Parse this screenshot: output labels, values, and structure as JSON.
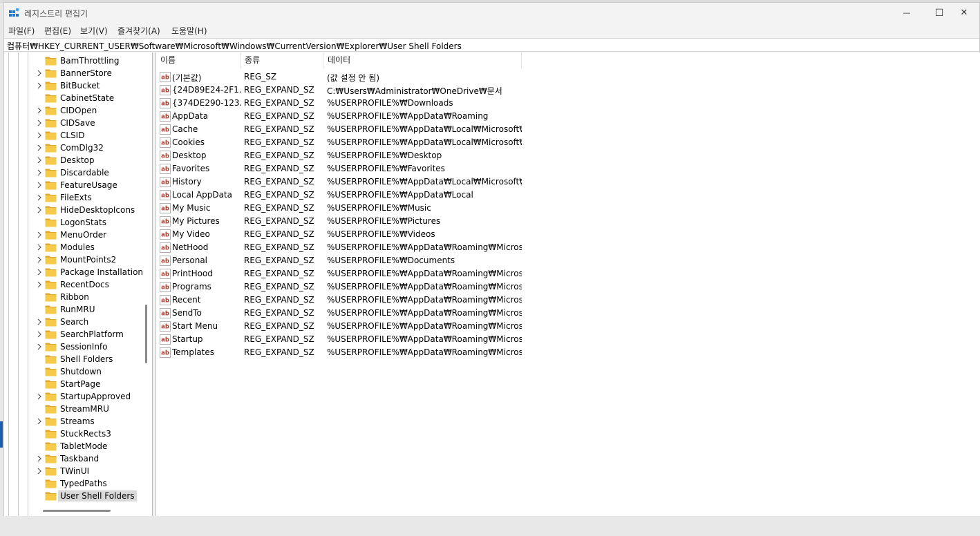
{
  "window": {
    "title": "레지스트리 편집기",
    "app_icon": "registry-editor-icon",
    "controls": {
      "minimize": "—",
      "maximize": "☐",
      "close": "✕"
    }
  },
  "menubar": {
    "items": [
      "파일(F)",
      "편집(E)",
      "보기(V)",
      "즐겨찾기(A)",
      "도움말(H)"
    ]
  },
  "address": {
    "path": "컴퓨터₩HKEY_CURRENT_USER₩Software₩Microsoft₩Windows₩CurrentVersion₩Explorer₩User Shell Folders"
  },
  "tree": {
    "items": [
      {
        "label": "BamThrottling",
        "expandable": false
      },
      {
        "label": "BannerStore",
        "expandable": true
      },
      {
        "label": "BitBucket",
        "expandable": true
      },
      {
        "label": "CabinetState",
        "expandable": false
      },
      {
        "label": "CIDOpen",
        "expandable": true
      },
      {
        "label": "CIDSave",
        "expandable": true
      },
      {
        "label": "CLSID",
        "expandable": true
      },
      {
        "label": "ComDlg32",
        "expandable": true
      },
      {
        "label": "Desktop",
        "expandable": true
      },
      {
        "label": "Discardable",
        "expandable": true
      },
      {
        "label": "FeatureUsage",
        "expandable": true
      },
      {
        "label": "FileExts",
        "expandable": true
      },
      {
        "label": "HideDesktopIcons",
        "expandable": true
      },
      {
        "label": "LogonStats",
        "expandable": false
      },
      {
        "label": "MenuOrder",
        "expandable": true
      },
      {
        "label": "Modules",
        "expandable": true
      },
      {
        "label": "MountPoints2",
        "expandable": true
      },
      {
        "label": "Package Installation",
        "expandable": true
      },
      {
        "label": "RecentDocs",
        "expandable": true
      },
      {
        "label": "Ribbon",
        "expandable": false
      },
      {
        "label": "RunMRU",
        "expandable": false
      },
      {
        "label": "Search",
        "expandable": true
      },
      {
        "label": "SearchPlatform",
        "expandable": true
      },
      {
        "label": "SessionInfo",
        "expandable": true
      },
      {
        "label": "Shell Folders",
        "expandable": false
      },
      {
        "label": "Shutdown",
        "expandable": false
      },
      {
        "label": "StartPage",
        "expandable": false
      },
      {
        "label": "StartupApproved",
        "expandable": true
      },
      {
        "label": "StreamMRU",
        "expandable": false
      },
      {
        "label": "Streams",
        "expandable": true
      },
      {
        "label": "StuckRects3",
        "expandable": false
      },
      {
        "label": "TabletMode",
        "expandable": false
      },
      {
        "label": "Taskband",
        "expandable": true
      },
      {
        "label": "TWinUI",
        "expandable": true
      },
      {
        "label": "TypedPaths",
        "expandable": false
      },
      {
        "label": "User Shell Folders",
        "expandable": false,
        "selected": true
      }
    ]
  },
  "list": {
    "columns": [
      "이름",
      "종류",
      "데이터"
    ],
    "rows": [
      {
        "name": "(기본값)",
        "type": "REG_SZ",
        "data": "(값 설정 안 됨)"
      },
      {
        "name": "{24D89E24-2F1...",
        "type": "REG_EXPAND_SZ",
        "data": "C:₩Users₩Administrator₩OneDrive₩문서"
      },
      {
        "name": "{374DE290-123...",
        "type": "REG_EXPAND_SZ",
        "data": "%USERPROFILE%₩Downloads"
      },
      {
        "name": "AppData",
        "type": "REG_EXPAND_SZ",
        "data": "%USERPROFILE%₩AppData₩Roaming"
      },
      {
        "name": "Cache",
        "type": "REG_EXPAND_SZ",
        "data": "%USERPROFILE%₩AppData₩Local₩Microsoft₩W..."
      },
      {
        "name": "Cookies",
        "type": "REG_EXPAND_SZ",
        "data": "%USERPROFILE%₩AppData₩Local₩Microsoft₩W..."
      },
      {
        "name": "Desktop",
        "type": "REG_EXPAND_SZ",
        "data": "%USERPROFILE%₩Desktop"
      },
      {
        "name": "Favorites",
        "type": "REG_EXPAND_SZ",
        "data": "%USERPROFILE%₩Favorites"
      },
      {
        "name": "History",
        "type": "REG_EXPAND_SZ",
        "data": "%USERPROFILE%₩AppData₩Local₩Microsoft₩W..."
      },
      {
        "name": "Local AppData",
        "type": "REG_EXPAND_SZ",
        "data": "%USERPROFILE%₩AppData₩Local"
      },
      {
        "name": "My Music",
        "type": "REG_EXPAND_SZ",
        "data": "%USERPROFILE%₩Music"
      },
      {
        "name": "My Pictures",
        "type": "REG_EXPAND_SZ",
        "data": "%USERPROFILE%₩Pictures"
      },
      {
        "name": "My Video",
        "type": "REG_EXPAND_SZ",
        "data": "%USERPROFILE%₩Videos"
      },
      {
        "name": "NetHood",
        "type": "REG_EXPAND_SZ",
        "data": "%USERPROFILE%₩AppData₩Roaming₩Microsoft..."
      },
      {
        "name": "Personal",
        "type": "REG_EXPAND_SZ",
        "data": "%USERPROFILE%₩Documents"
      },
      {
        "name": "PrintHood",
        "type": "REG_EXPAND_SZ",
        "data": "%USERPROFILE%₩AppData₩Roaming₩Microsoft..."
      },
      {
        "name": "Programs",
        "type": "REG_EXPAND_SZ",
        "data": "%USERPROFILE%₩AppData₩Roaming₩Microsoft..."
      },
      {
        "name": "Recent",
        "type": "REG_EXPAND_SZ",
        "data": "%USERPROFILE%₩AppData₩Roaming₩Microsoft..."
      },
      {
        "name": "SendTo",
        "type": "REG_EXPAND_SZ",
        "data": "%USERPROFILE%₩AppData₩Roaming₩Microsoft..."
      },
      {
        "name": "Start Menu",
        "type": "REG_EXPAND_SZ",
        "data": "%USERPROFILE%₩AppData₩Roaming₩Microsoft..."
      },
      {
        "name": "Startup",
        "type": "REG_EXPAND_SZ",
        "data": "%USERPROFILE%₩AppData₩Roaming₩Microsoft..."
      },
      {
        "name": "Templates",
        "type": "REG_EXPAND_SZ",
        "data": "%USERPROFILE%₩AppData₩Roaming₩Microsoft..."
      }
    ]
  },
  "icons": {
    "value": "string-value-icon",
    "folder": "folder-icon",
    "chevron": "chevron-right-icon"
  },
  "colors": {
    "folder": "#f7c948",
    "folder_dark": "#e0a82e",
    "ab_red": "#c0392b",
    "selection": "#d9d9d9"
  }
}
